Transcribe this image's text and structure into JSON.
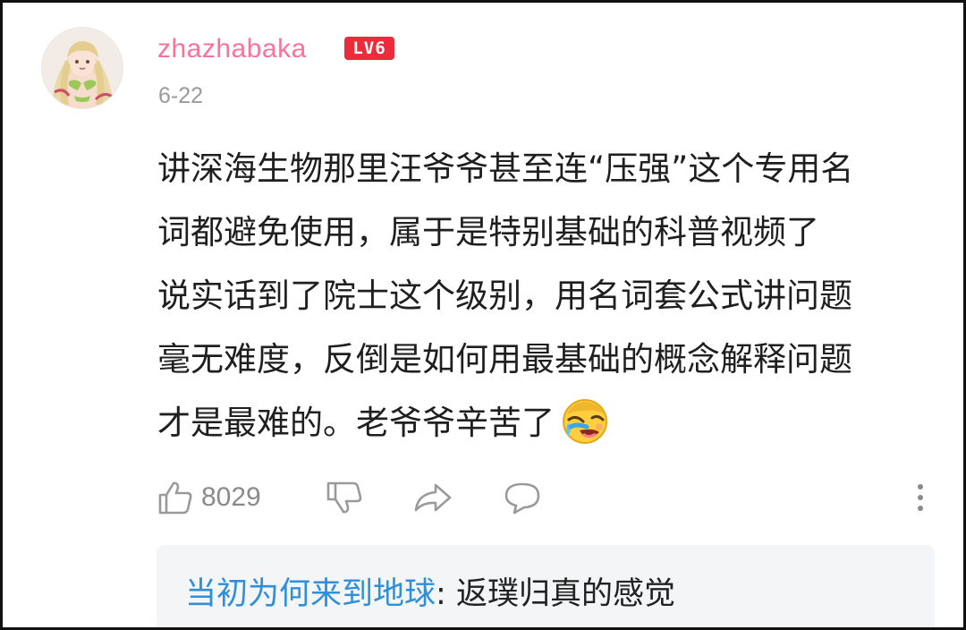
{
  "comment": {
    "avatar_icon": "anime-girl-avatar",
    "username": "zhazhabaka",
    "level_badge": "LV6",
    "date": "6-22",
    "content_lines": [
      "讲深海生物那里汪爷爷甚至连“压强”这个专用名",
      "词都避免使用，属于是特别基础的科普视频了",
      "说实话到了院士这个级别，用名词套公式讲问题",
      "毫无难度，反倒是如何用最基础的概念解释问题",
      "才是最难的。老爷爷辛苦了"
    ],
    "emoji_icon": "crying-laughing-emoji",
    "colors": {
      "username": "#fb7299",
      "level_badge": "#ee2b3a",
      "reply_username": "#2f8fd8"
    }
  },
  "actions": {
    "like_icon": "thumbs-up-icon",
    "like_count": "8029",
    "dislike_icon": "thumbs-down-icon",
    "share_icon": "share-icon",
    "reply_icon": "comment-bubble-icon",
    "more_icon": "more-vertical-icon"
  },
  "reply_preview": {
    "username": "当初为何来到地球",
    "separator": ": ",
    "text": "返璞归真的感觉"
  }
}
